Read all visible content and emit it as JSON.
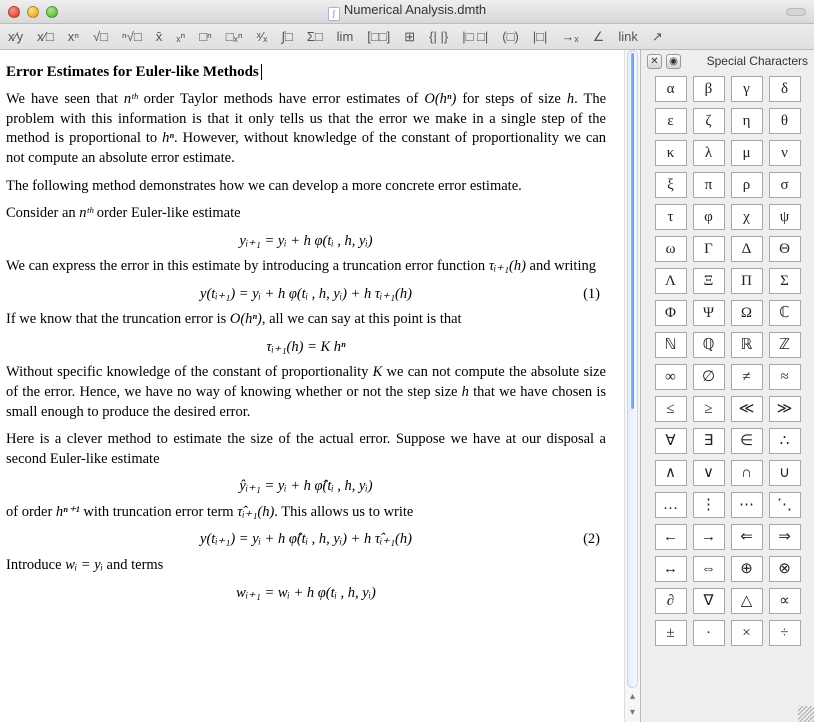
{
  "window": {
    "title": "Numerical Analysis.dmth"
  },
  "toolbar": {
    "items": [
      {
        "id": "frac1",
        "glyph": "x⁄y"
      },
      {
        "id": "frac2",
        "glyph": "x⁄□"
      },
      {
        "id": "sup",
        "glyph": "xⁿ"
      },
      {
        "id": "sqrt",
        "glyph": "√□"
      },
      {
        "id": "nsqrt",
        "glyph": "ⁿ√□"
      },
      {
        "id": "xbar",
        "glyph": "x̄"
      },
      {
        "id": "subsup",
        "glyph": "ₓⁿ"
      },
      {
        "id": "boxsup",
        "glyph": "□ⁿ"
      },
      {
        "id": "boxsubsup",
        "glyph": "□ₓⁿ"
      },
      {
        "id": "smallfrac",
        "glyph": "ˣ⁄ₓ"
      },
      {
        "id": "intbox",
        "glyph": "∫□"
      },
      {
        "id": "sumbox",
        "glyph": "Σ□"
      },
      {
        "id": "lim",
        "glyph": "lim"
      },
      {
        "id": "matrix",
        "glyph": "[□□]"
      },
      {
        "id": "grid",
        "glyph": "⊞"
      },
      {
        "id": "pair1",
        "glyph": "{| |}"
      },
      {
        "id": "pair2",
        "glyph": "|□ □|"
      },
      {
        "id": "paren",
        "glyph": "(□)"
      },
      {
        "id": "abs",
        "glyph": "|□|"
      },
      {
        "id": "arrow",
        "glyph": "→ₓ"
      },
      {
        "id": "angle",
        "glyph": "∠"
      },
      {
        "id": "link",
        "glyph": "link"
      },
      {
        "id": "arrowdiag",
        "glyph": "↗"
      }
    ]
  },
  "sidepanel": {
    "title": "Special Characters",
    "symbols": [
      "α",
      "β",
      "γ",
      "δ",
      "ε",
      "ζ",
      "η",
      "θ",
      "κ",
      "λ",
      "μ",
      "ν",
      "ξ",
      "π",
      "ρ",
      "σ",
      "τ",
      "φ",
      "χ",
      "ψ",
      "ω",
      "Γ",
      "Δ",
      "Θ",
      "Λ",
      "Ξ",
      "Π",
      "Σ",
      "Φ",
      "Ψ",
      "Ω",
      "ℂ",
      "ℕ",
      "ℚ",
      "ℝ",
      "ℤ",
      "∞",
      "∅",
      "≠",
      "≈",
      "≤",
      "≥",
      "≪",
      "≫",
      "∀",
      "∃",
      "∈",
      "∴",
      "∧",
      "∨",
      "∩",
      "∪",
      "…",
      "⋮",
      "⋯",
      "⋱",
      "←",
      "→",
      "⇐",
      "⇒",
      "↔",
      "⇔",
      "⊕",
      "⊗",
      "∂",
      "∇",
      "△",
      "∝",
      "±",
      "·",
      "×",
      "÷"
    ]
  },
  "document": {
    "title": "Error Estimates for Euler-like Methods",
    "p1a": "We have seen that ",
    "p1b": " order Taylor methods have error estimates of ",
    "p1c": " for steps of size ",
    "p1d": ". The problem with this information is that it only tells us that the error we make in a single step of the method is proportional to ",
    "p1e": ". However, without knowledge of the constant of proportionality we can not compute an absolute error estimate.",
    "p2": "The following method demonstrates how we can develop a more concrete error estimate.",
    "p3a": "Consider an ",
    "p3b": " order Euler-like estimate",
    "eq1": "yᵢ₊₁ = yᵢ + h φ(tᵢ , h, yᵢ)",
    "p4a": "We can express the error in this estimate by introducing a truncation error function ",
    "p4b": " and writing",
    "eq2": "y(tᵢ₊₁) = yᵢ + h φ(tᵢ , h, yᵢ) + h τᵢ₊₁(h)",
    "eq2num": "(1)",
    "p5a": "If we know that the truncation error is ",
    "p5b": ", all we can say at this point is that",
    "eq3": "τᵢ₊₁(h) = K hⁿ",
    "p6a": "Without specific knowledge of the constant of proportionality ",
    "p6b": " we can not compute the absolute size of the error. Hence, we have no way of knowing whether or not the step size ",
    "p6c": " that we have chosen is small enough to produce the desired error.",
    "p7": "Here is a clever method to estimate the size of the actual error. Suppose we have at our disposal a second Euler-like estimate",
    "eq4": "ŷᵢ₊₁ = yᵢ + h φ̂(tᵢ , h, yᵢ)",
    "p8a": "of order ",
    "p8b": " with truncation error term ",
    "p8c": ". This allows us to write",
    "eq5": "y(tᵢ₊₁) = yᵢ + h φ̂(tᵢ , h, yᵢ) + h τ̂ᵢ₊₁(h)",
    "eq5num": "(2)",
    "p9a": "Introduce ",
    "p9b": " and terms",
    "eq6": "wᵢ₊₁ = wᵢ + h φ(tᵢ , h, yᵢ)",
    "nth": "nᵗʰ",
    "Ohn": "O(hⁿ)",
    "h": "h",
    "hn": "hⁿ",
    "tau": "τᵢ₊₁(h)",
    "K": "K",
    "hnp1": "hⁿ⁺¹",
    "tauhat": "τ̂ᵢ₊₁(h)",
    "wi_eq_yi": "wᵢ = yᵢ"
  }
}
